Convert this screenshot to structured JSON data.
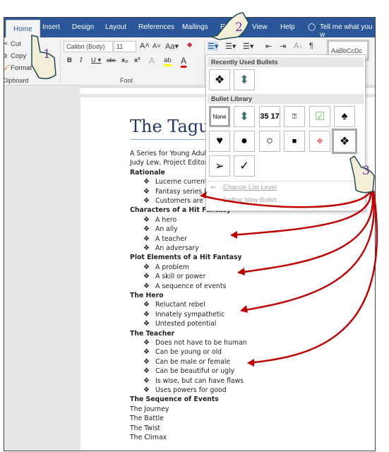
{
  "ribbon": {
    "tabs": [
      "Home",
      "Insert",
      "Design",
      "Layout",
      "References",
      "Mailings",
      "Review",
      "View",
      "Help"
    ],
    "tell_me": "Tell me what you w",
    "clipboard": {
      "cut": "Cut",
      "copy": "Copy",
      "format_painter": "Format Painter",
      "label": "Clipboard"
    },
    "font": {
      "name": "Calibri (Body)",
      "size": "11",
      "label": "Font"
    },
    "style_preview": "AaBbCcDc"
  },
  "dropdown": {
    "recent_header": "Recently Used Bullets",
    "library_header": "Bullet Library",
    "none_label": "None",
    "numbers_glyph": "35 17",
    "change_level": "Change List Level",
    "define_new": "Define New Bullet..."
  },
  "document": {
    "title": "The Taguchi",
    "lines": [
      {
        "t": "A Series for Young Adult",
        "k": "p"
      },
      {
        "t": "Judy Lew, Project Editor",
        "k": "p"
      },
      {
        "t": "Rationale",
        "k": "h"
      },
      {
        "t": "Lucerne current",
        "k": "i"
      },
      {
        "t": "Fantasy series b",
        "k": "i"
      },
      {
        "t": "Customers are t",
        "k": "i"
      },
      {
        "t": "Characters of a Hit Fantasy",
        "k": "h"
      },
      {
        "t": "A hero",
        "k": "i"
      },
      {
        "t": "An ally",
        "k": "i"
      },
      {
        "t": "A teacher",
        "k": "i"
      },
      {
        "t": "An adversary",
        "k": "i"
      },
      {
        "t": "Plot Elements of a Hit Fantasy",
        "k": "h"
      },
      {
        "t": "A problem",
        "k": "i"
      },
      {
        "t": "A skill or power",
        "k": "i"
      },
      {
        "t": "A sequence of events",
        "k": "i"
      },
      {
        "t": "The Hero",
        "k": "h"
      },
      {
        "t": "Reluctant rebel",
        "k": "i"
      },
      {
        "t": "Innately sympathetic",
        "k": "i"
      },
      {
        "t": "Untested potential",
        "k": "i"
      },
      {
        "t": "The Teacher",
        "k": "h"
      },
      {
        "t": "Does not have to be human",
        "k": "i"
      },
      {
        "t": "Can be young or old",
        "k": "i"
      },
      {
        "t": "Can be male or female",
        "k": "i"
      },
      {
        "t": "Can be beautiful or ugly",
        "k": "i"
      },
      {
        "t": "Is wise, but can have flaws",
        "k": "i"
      },
      {
        "t": "Uses powers for good",
        "k": "i"
      },
      {
        "t": "The Sequence of Events",
        "k": "h"
      },
      {
        "t": "The Journey",
        "k": "p"
      },
      {
        "t": "The Battle",
        "k": "p"
      },
      {
        "t": "The Twist",
        "k": "p"
      },
      {
        "t": "The Climax",
        "k": "p"
      }
    ]
  },
  "callouts": [
    "1",
    "2",
    "3"
  ],
  "colors": {
    "ribbon_blue": "#2b579a",
    "title_blue": "#1f3864",
    "arrow_red": "#c00000",
    "step_purple": "#7030a0"
  }
}
